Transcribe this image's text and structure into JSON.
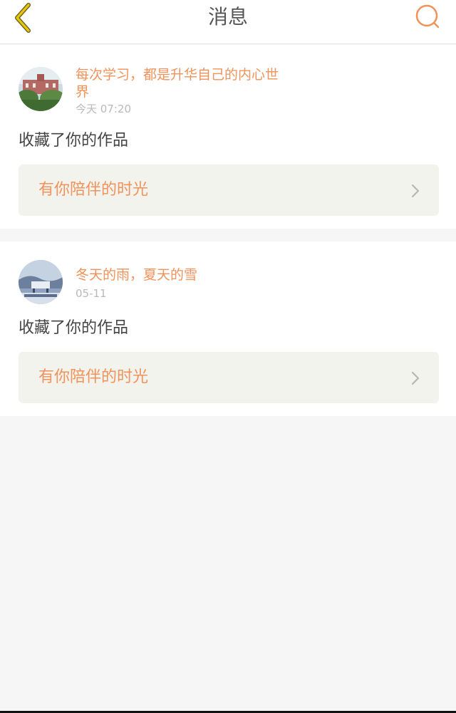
{
  "header": {
    "title": "消息",
    "back_icon": "back-arrow-icon",
    "search_icon": "search-icon",
    "accent_color": "#f0925a",
    "back_icon_color": "#e6c400"
  },
  "messages": [
    {
      "user_name": "每次学习，都是升华自己的内心世界",
      "time": "今天 07:20",
      "action": "收藏了你的作品",
      "work_title": "有你陪伴的时光"
    },
    {
      "user_name": "冬天的雨，夏天的雪",
      "time": "05-11",
      "action": "收藏了你的作品",
      "work_title": "有你陪伴的时光"
    }
  ]
}
